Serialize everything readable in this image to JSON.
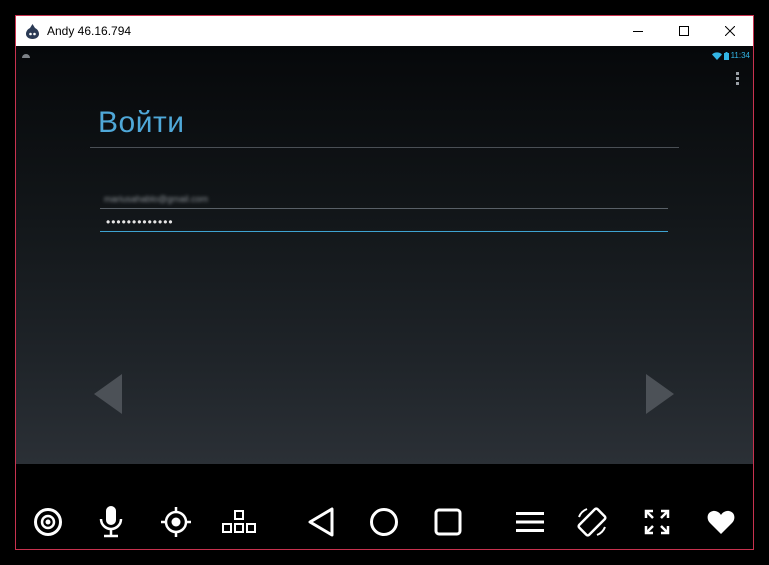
{
  "window": {
    "title": "Andy 46.16.794",
    "controls": [
      "minimize",
      "maximize",
      "close"
    ]
  },
  "status_bar": {
    "left_icon": "android-debug-icon",
    "icons": [
      "wifi-icon",
      "battery-icon"
    ],
    "time": "11:34"
  },
  "login": {
    "heading": "Войти",
    "email_value": "mariusahablo@gmail.com",
    "password_value": "•••••••••••••"
  },
  "toolbar": {
    "icons": [
      "camera-icon",
      "microphone-icon",
      "location-icon",
      "keymap-icon",
      "back-icon",
      "home-icon",
      "recents-icon",
      "menu-icon",
      "rotate-icon",
      "fullscreen-icon",
      "favorite-icon"
    ]
  },
  "colors": {
    "accent": "#33b5e5",
    "window_border": "#c8324f"
  }
}
